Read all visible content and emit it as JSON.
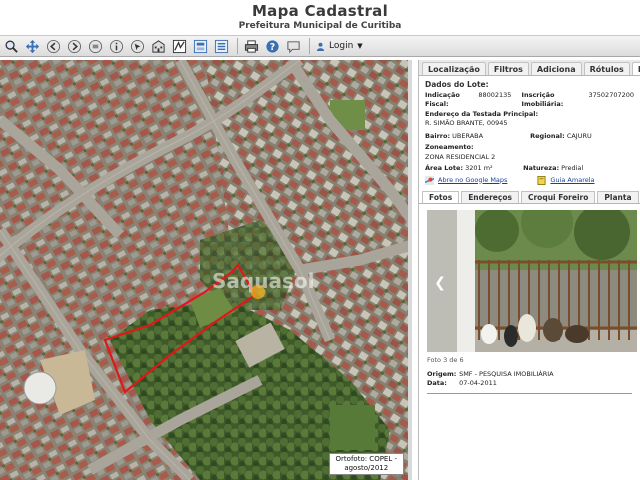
{
  "header": {
    "title": "Mapa Cadastral",
    "subtitle": "Prefeitura Municipal de Curitiba"
  },
  "toolbar": {
    "login_label": "Login",
    "tools": [
      "zoom-icon",
      "pan-icon",
      "back-icon",
      "forward-icon",
      "measure-icon",
      "info-icon",
      "select-icon",
      "building-icon",
      "layers-icon",
      "identify-icon",
      "legend-icon",
      "print-icon",
      "help-icon",
      "comment-icon"
    ]
  },
  "map": {
    "ortho_label_line1": "Ortofoto: COPEL -",
    "ortho_label_line2": "agosto/2012",
    "watermark": "Saquasol"
  },
  "panel": {
    "tabs": [
      "Localização",
      "Filtros",
      "Adiciona",
      "Rótulos",
      "Dados"
    ],
    "active_tab": "Dados",
    "lot": {
      "heading": "Dados do Lote:",
      "indicacao_label": "Indicação Fiscal:",
      "indicacao_value": "88002135",
      "inscricao_label": "Inscrição Imobiliária:",
      "inscricao_value": "37502707200",
      "endereco_label": "Endereço da Testada Principal:",
      "endereco_value": "R. SIMÃO BRANTE, 00945",
      "bairro_label": "Bairro:",
      "bairro_value": "UBERABA",
      "regional_label": "Regional:",
      "regional_value": "CAJURU",
      "zoneamento_label": "Zoneamento:",
      "zoneamento_value": "ZONA RESIDENCIAL 2",
      "area_label": "Área Lote:",
      "area_value": "3201 m²",
      "natureza_label": "Natureza:",
      "natureza_value": "Predial",
      "link_maps": "Abre no Google Maps",
      "link_guia": "Guia Amarela"
    },
    "subtabs": [
      "Fotos",
      "Endereços",
      "Croqui Foreiro",
      "Planta"
    ],
    "active_subtab": "Fotos",
    "photo": {
      "counter": "Foto 3 de 6",
      "origem_label": "Origem:",
      "origem_value": "SMF - PESQUISA IMOBILIÁRIA",
      "data_label": "Data:",
      "data_value": "07-04-2011"
    }
  },
  "colors": {
    "tab_bg": "#f2f2f2",
    "link": "#1a3f9a",
    "lot_outline": "#e01818",
    "aerial_roof": "#a4574a"
  }
}
